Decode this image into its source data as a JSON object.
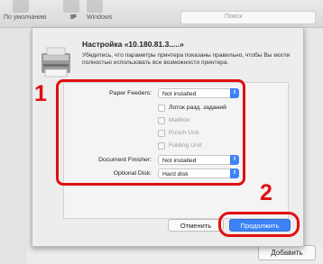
{
  "toolbar": {
    "tabs": [
      "По умолчанию",
      "IP",
      "Windows"
    ],
    "search_label": "Поиск",
    "add_label": "Добавить"
  },
  "dialog": {
    "title": "Настройка «10.180.81.3.....»",
    "description": "Убедитесь, что параметры принтера показаны правильно, чтобы Вы могли полностью использовать все возможности принтера.",
    "options": {
      "paper_feeders_label": "Paper Feeders:",
      "paper_feeders_value": "Not installed",
      "checkboxes": [
        {
          "label": "Лоток разд. заданий",
          "enabled": true
        },
        {
          "label": "Mailbox",
          "enabled": false
        },
        {
          "label": "Punch Unit",
          "enabled": false
        },
        {
          "label": "Folding Unit",
          "enabled": false
        }
      ],
      "document_finisher_label": "Document Finisher:",
      "document_finisher_value": "Not installed",
      "optional_disk_label": "Optional Disk:",
      "optional_disk_value": "Hard disk"
    },
    "cancel_label": "Отменить",
    "continue_label": "Продолжить"
  },
  "callouts": [
    "1",
    "2"
  ],
  "colors": {
    "accent": "#3b82f6",
    "callout": "#e01010"
  }
}
